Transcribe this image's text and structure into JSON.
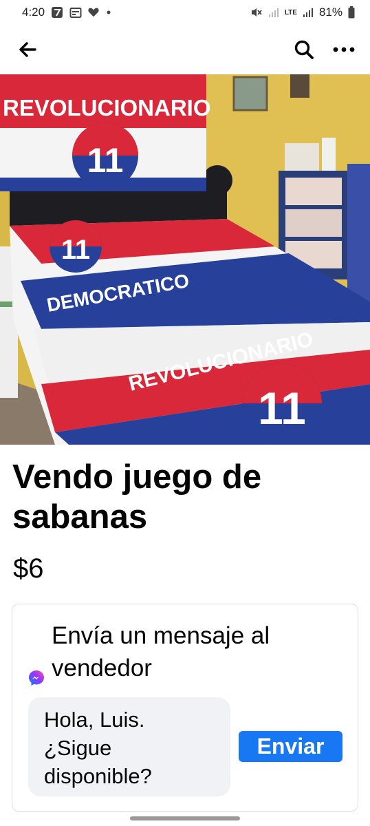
{
  "status_bar": {
    "time": "4:20",
    "network": "LTE",
    "battery": "81%",
    "icons": [
      "app-notification-icon",
      "calendar-icon",
      "heart-icon",
      "dot-icon",
      "mute-icon",
      "signal-icon",
      "battery-icon"
    ]
  },
  "app_bar": {
    "icons": [
      "back-arrow-icon",
      "search-icon",
      "more-icon"
    ]
  },
  "listing": {
    "photo_description_icon": "bedsheet-photo",
    "photo_text": {
      "banner_top": "REVOLUCIONARIO",
      "number": "11",
      "bed_text_1": "DEMOCRATICO",
      "bed_text_2": "REVOLUCIONARIO"
    },
    "title": "Vendo juego de sabanas",
    "price": "$6"
  },
  "message_card": {
    "heading": "Envía un mensaje al vendedor",
    "message_value": "Hola, Luis.\n¿Sigue\ndisponible?",
    "send_label": "Enviar",
    "accent_color": "#1877f2"
  }
}
